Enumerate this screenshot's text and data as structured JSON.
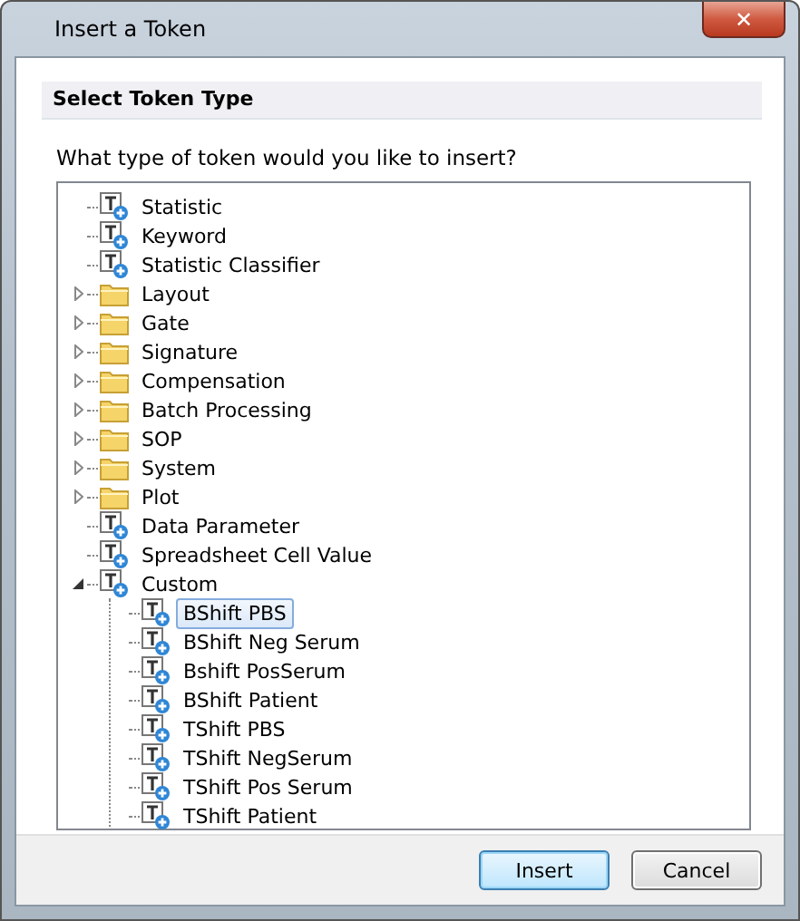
{
  "window": {
    "title": "Insert a Token",
    "close": "✕"
  },
  "header": "Select Token Type",
  "prompt": "What type of token would you like to insert?",
  "tree": [
    {
      "label": "Statistic",
      "kind": "token",
      "selected": false
    },
    {
      "label": "Keyword",
      "kind": "token",
      "selected": false
    },
    {
      "label": "Statistic Classifier",
      "kind": "token",
      "selected": false
    },
    {
      "label": "Layout",
      "kind": "folder",
      "selected": false,
      "expanded": false
    },
    {
      "label": "Gate",
      "kind": "folder",
      "selected": false,
      "expanded": false
    },
    {
      "label": "Signature",
      "kind": "folder",
      "selected": false,
      "expanded": false
    },
    {
      "label": "Compensation",
      "kind": "folder",
      "selected": false,
      "expanded": false
    },
    {
      "label": "Batch Processing",
      "kind": "folder",
      "selected": false,
      "expanded": false
    },
    {
      "label": "SOP",
      "kind": "folder",
      "selected": false,
      "expanded": false
    },
    {
      "label": "System",
      "kind": "folder",
      "selected": false,
      "expanded": false
    },
    {
      "label": "Plot",
      "kind": "folder",
      "selected": false,
      "expanded": false
    },
    {
      "label": "Data Parameter",
      "kind": "token",
      "selected": false
    },
    {
      "label": "Spreadsheet Cell Value",
      "kind": "token",
      "selected": false
    },
    {
      "label": "Custom",
      "kind": "token",
      "selected": false,
      "expanded": true,
      "children": [
        {
          "label": "BShift PBS",
          "kind": "token",
          "selected": true
        },
        {
          "label": "BShift Neg Serum",
          "kind": "token",
          "selected": false
        },
        {
          "label": "Bshift PosSerum",
          "kind": "token",
          "selected": false
        },
        {
          "label": "BShift Patient",
          "kind": "token",
          "selected": false
        },
        {
          "label": "TShift PBS",
          "kind": "token",
          "selected": false
        },
        {
          "label": "TShift NegSerum",
          "kind": "token",
          "selected": false
        },
        {
          "label": "TShift Pos Serum",
          "kind": "token",
          "selected": false
        },
        {
          "label": "TShift Patient",
          "kind": "token",
          "selected": false
        }
      ]
    }
  ],
  "buttons": [
    {
      "label": "Insert",
      "default": true
    },
    {
      "label": "Cancel",
      "default": false
    }
  ]
}
